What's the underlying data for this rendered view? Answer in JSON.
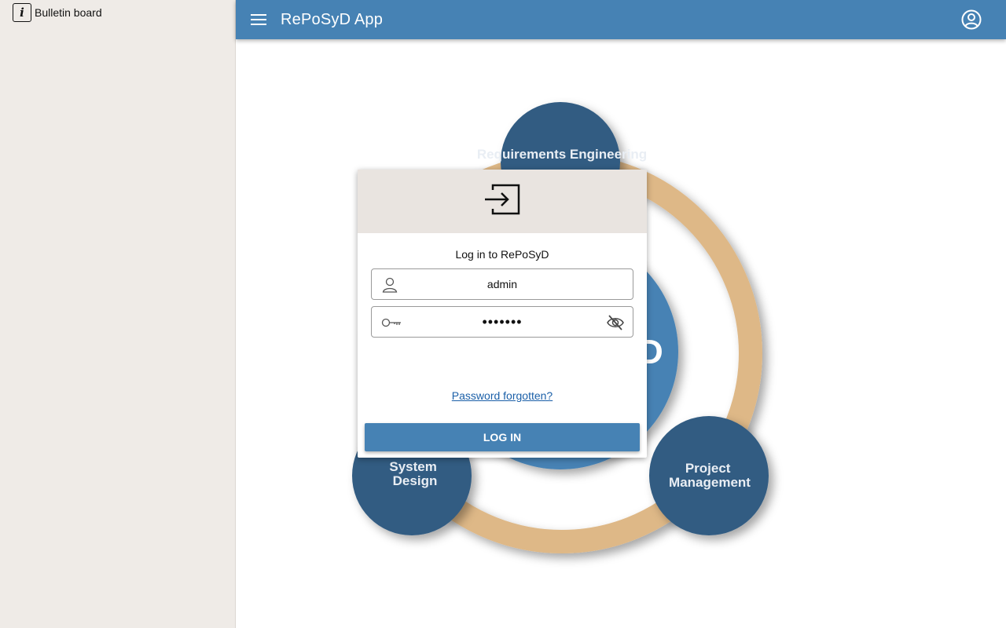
{
  "sidebar": {
    "items": [
      {
        "label": "Bulletin board",
        "icon": "info-icon"
      }
    ]
  },
  "topbar": {
    "title": "RePoSyD App",
    "menu_icon": "menu-icon",
    "account_icon": "account-circle-icon",
    "color": "#4682b4"
  },
  "background_graphic": {
    "nodes": [
      "Requirements Engineering",
      "System Design",
      "Project Management"
    ],
    "node_color": "#315b82",
    "center_color": "#4682b4",
    "ring_color": "#deb887"
  },
  "login": {
    "header_icon": "login-icon",
    "title": "Log in to RePoSyD",
    "username": {
      "value": "admin",
      "icon": "user-icon"
    },
    "password": {
      "value": "•••••••",
      "icon": "key-icon",
      "toggle_icon": "eye-off-icon"
    },
    "forgot_link": "Password forgotten?",
    "submit_label": "LOG IN"
  }
}
